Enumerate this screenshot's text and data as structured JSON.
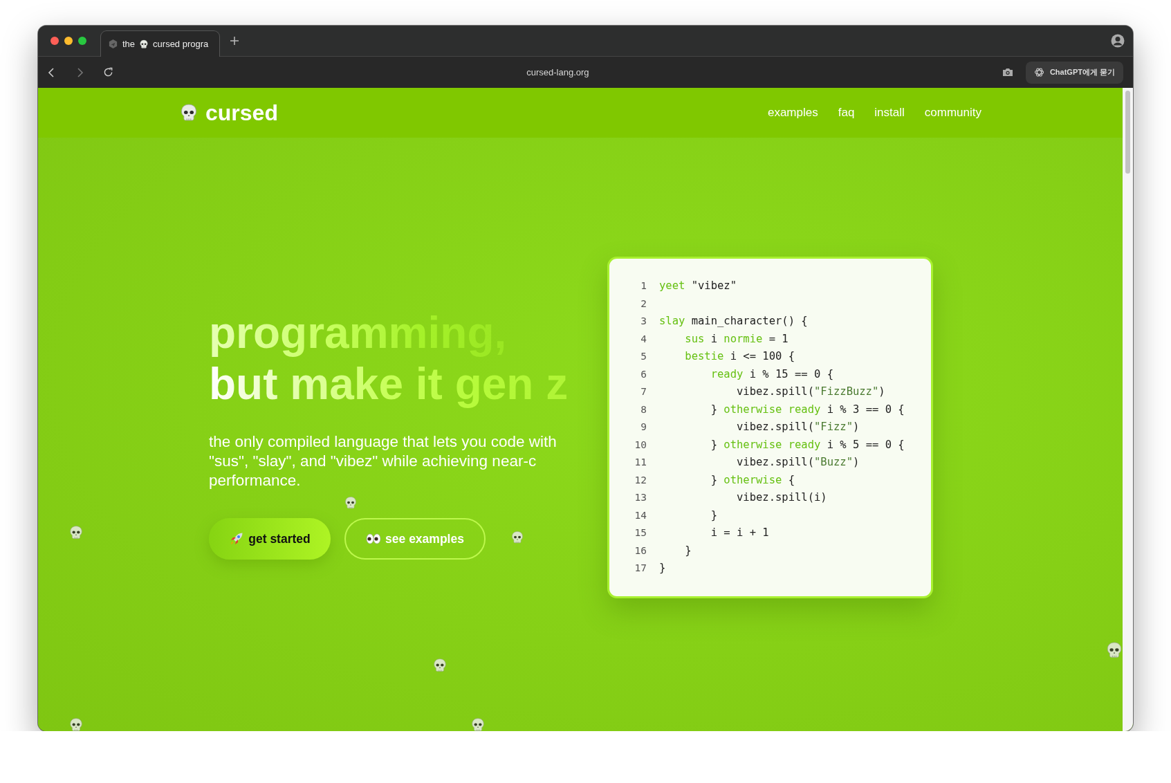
{
  "browser": {
    "tab": {
      "title_start": "the",
      "title_end": "cursed progra",
      "selected": true
    },
    "address": "cursed-lang.org",
    "assistant_button": "ChatGPT에게 묻기"
  },
  "site": {
    "logo": "cursed",
    "nav": [
      {
        "label": "examples"
      },
      {
        "label": "faq"
      },
      {
        "label": "install"
      },
      {
        "label": "community"
      }
    ]
  },
  "hero": {
    "headline": [
      "programming,",
      "but make it gen z"
    ],
    "tagline": "the only compiled language that lets you code with \"sus\", \"slay\", and \"vibez\" while achieving near-c performance.",
    "buttons": [
      {
        "label": "get started",
        "kind": "primary"
      },
      {
        "label": "see examples",
        "kind": "outline"
      }
    ]
  },
  "code": {
    "lines": [
      {
        "number": "1",
        "tokens": [
          {
            "kind": "keyword",
            "text": "yeet"
          },
          {
            "kind": "plain",
            "text": " \"vibez\""
          }
        ]
      },
      {
        "number": "2"
      },
      {
        "number": "3",
        "tokens": [
          {
            "kind": "keyword",
            "text": "slay"
          },
          {
            "kind": "plain",
            "text": " main_character() {"
          }
        ]
      },
      {
        "number": "4",
        "tokens": [
          {
            "kind": "keyword",
            "text": "    sus"
          },
          {
            "kind": "plain",
            "text": " i "
          },
          {
            "kind": "keyword",
            "text": "normie"
          },
          {
            "kind": "plain",
            "text": " = 1"
          }
        ]
      },
      {
        "number": "5",
        "tokens": [
          {
            "kind": "keyword",
            "text": "    bestie"
          },
          {
            "kind": "plain",
            "text": " i <= 100 {"
          }
        ]
      },
      {
        "number": "6",
        "tokens": [
          {
            "kind": "keyword",
            "text": "        ready"
          },
          {
            "kind": "plain",
            "text": " i % 15 == 0 {"
          }
        ]
      },
      {
        "number": "7",
        "tokens": [
          {
            "kind": "plain",
            "text": "            vibez.spill("
          },
          {
            "kind": "string",
            "text": "\"FizzBuzz\""
          },
          {
            "kind": "plain",
            "text": ")"
          }
        ]
      },
      {
        "number": "8",
        "tokens": [
          {
            "kind": "plain",
            "text": "        } "
          },
          {
            "kind": "keyword",
            "text": "otherwise ready"
          },
          {
            "kind": "plain",
            "text": " i % 3 == 0 {"
          }
        ]
      },
      {
        "number": "9",
        "tokens": [
          {
            "kind": "plain",
            "text": "            vibez.spill("
          },
          {
            "kind": "string",
            "text": "\"Fizz\""
          },
          {
            "kind": "plain",
            "text": ")"
          }
        ]
      },
      {
        "number": "10",
        "tokens": [
          {
            "kind": "plain",
            "text": "        } "
          },
          {
            "kind": "keyword",
            "text": "otherwise ready"
          },
          {
            "kind": "plain",
            "text": " i % 5 == 0 {"
          }
        ]
      },
      {
        "number": "11",
        "tokens": [
          {
            "kind": "plain",
            "text": "            vibez.spill("
          },
          {
            "kind": "string",
            "text": "\"Buzz\""
          },
          {
            "kind": "plain",
            "text": ")"
          }
        ]
      },
      {
        "number": "12",
        "tokens": [
          {
            "kind": "plain",
            "text": "        } "
          },
          {
            "kind": "keyword",
            "text": "otherwise"
          },
          {
            "kind": "plain",
            "text": " {"
          }
        ]
      },
      {
        "number": "13",
        "tokens": [
          {
            "kind": "plain",
            "text": "            vibez.spill(i)"
          }
        ]
      },
      {
        "number": "14",
        "tokens": [
          {
            "kind": "plain",
            "text": "        }"
          }
        ]
      },
      {
        "number": "15",
        "tokens": [
          {
            "kind": "plain",
            "text": "        i = i + 1"
          }
        ]
      },
      {
        "number": "16",
        "tokens": [
          {
            "kind": "plain",
            "text": "    }"
          }
        ]
      },
      {
        "number": "17",
        "tokens": [
          {
            "kind": "plain",
            "text": "}"
          }
        ]
      }
    ]
  }
}
